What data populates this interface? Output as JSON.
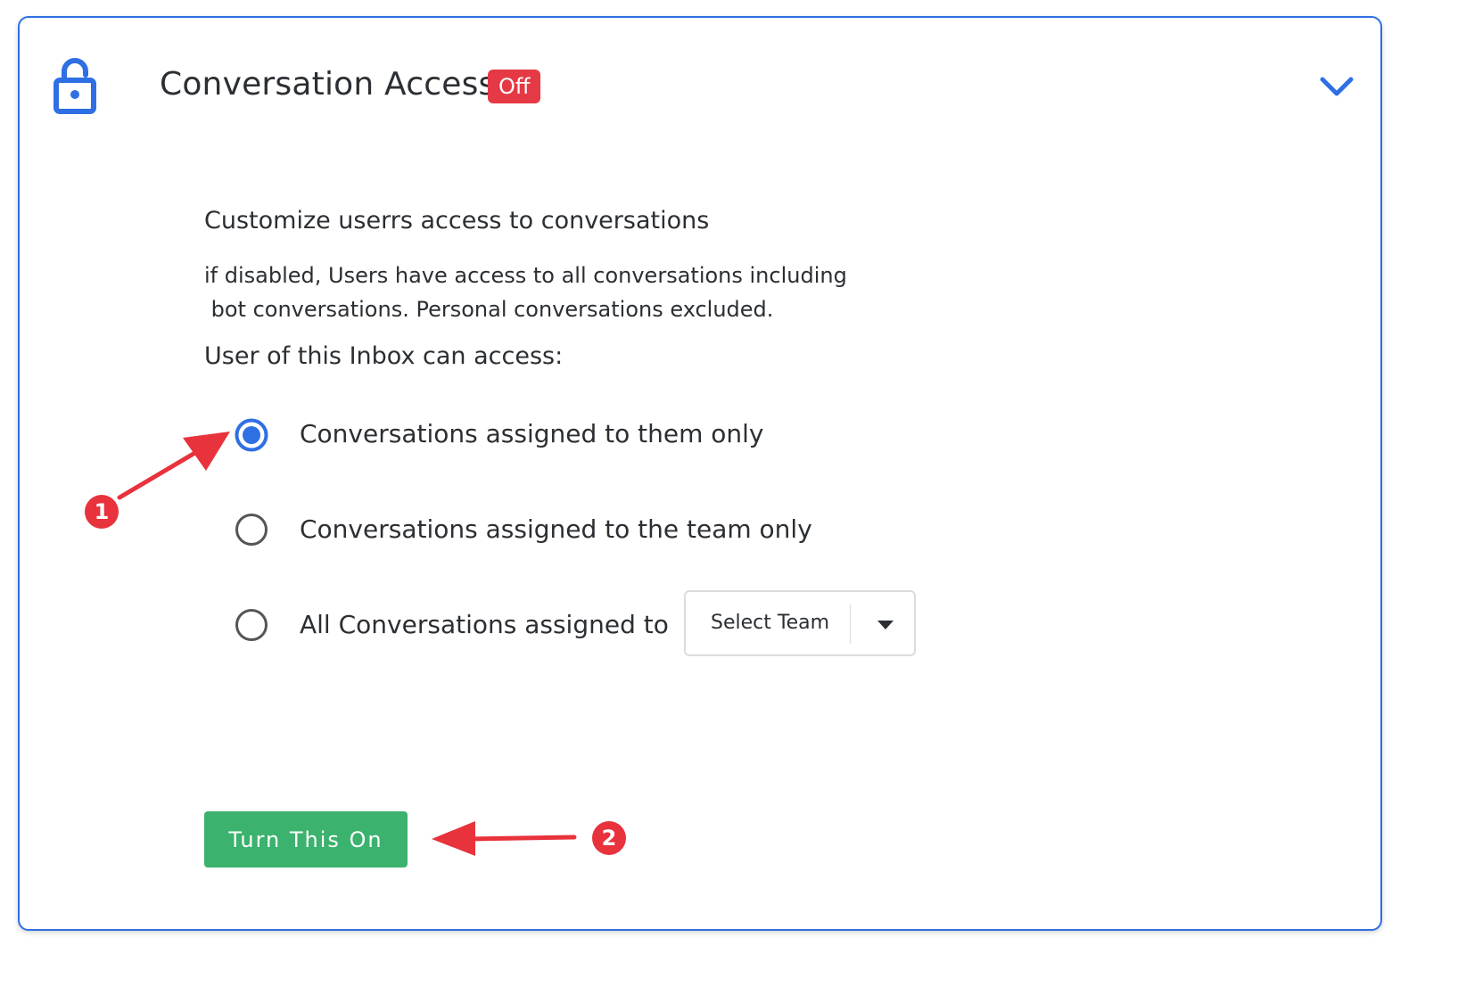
{
  "header": {
    "title": "Conversation Access",
    "status_badge": "Off",
    "icon": "unlocked-padlock-icon",
    "toggle_icon": "chevron-down-icon"
  },
  "content": {
    "heading": "Customize userrs access to conversations",
    "description_line1": "if disabled, Users have access to all conversations including",
    "description_line2": " bot conversations. Personal conversations excluded.",
    "access_label": "User of this Inbox can access:"
  },
  "options": [
    {
      "label": "Conversations assigned to them only",
      "selected": true
    },
    {
      "label": "Conversations assigned to the team only",
      "selected": false
    },
    {
      "label": "All Conversations assigned to",
      "selected": false
    }
  ],
  "team_select": {
    "value": "Select Team"
  },
  "action_button": {
    "label": "Turn This On"
  },
  "annotations": [
    {
      "number": "1"
    },
    {
      "number": "2"
    }
  ],
  "colors": {
    "accent": "#2f6fe4",
    "badge_red": "#e53945",
    "button_green": "#3bb26d",
    "annotation_red": "#e8323c"
  }
}
